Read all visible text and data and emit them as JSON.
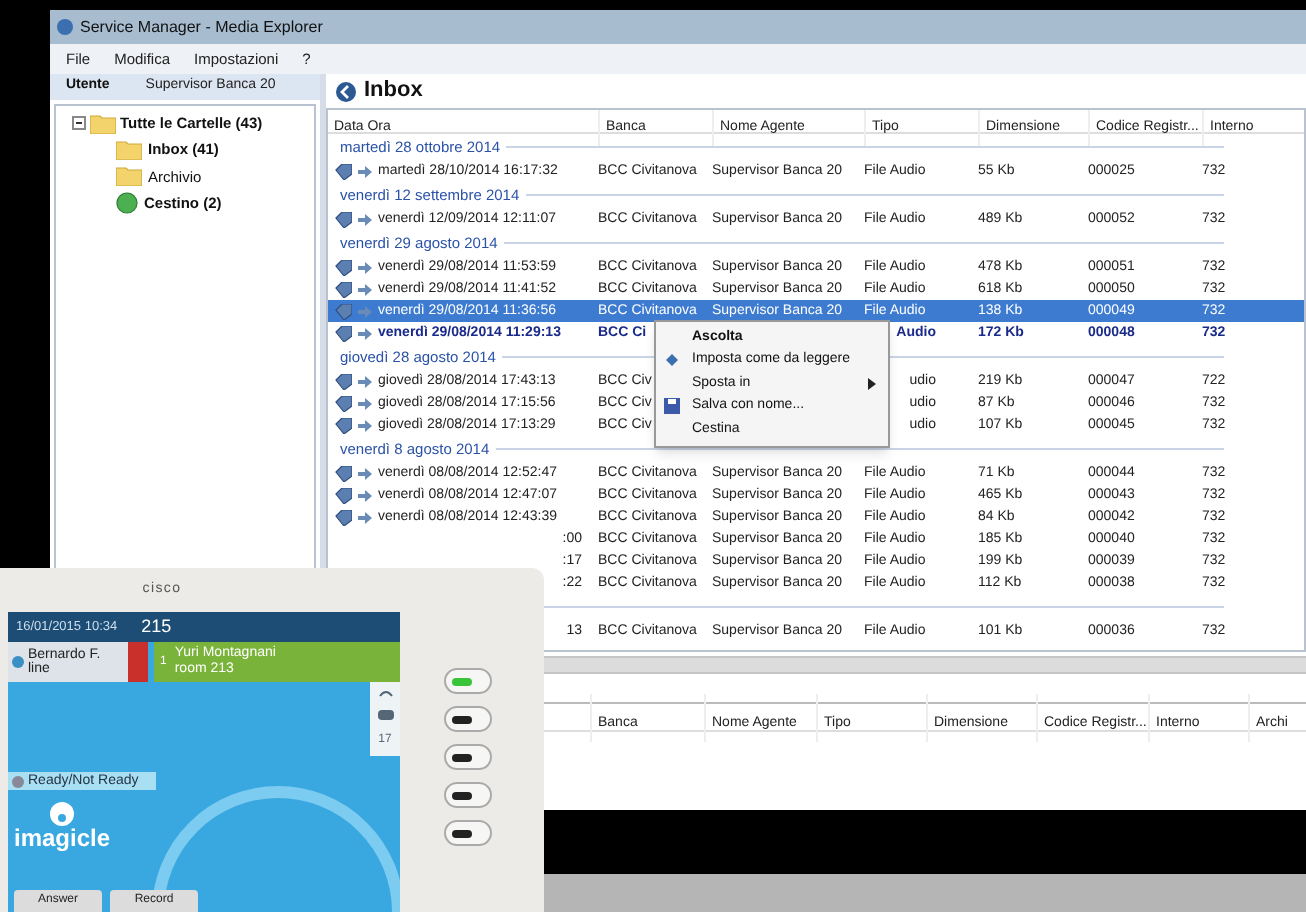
{
  "window": {
    "title": "Service Manager - Media Explorer"
  },
  "menu": [
    "File",
    "Modifica",
    "Impostazioni",
    "?"
  ],
  "user_bar": {
    "label": "Utente",
    "value": "Supervisor Banca 20"
  },
  "folders": {
    "label": "Tutte le Cartelle (43)",
    "expanded": true,
    "unread": true,
    "children": [
      {
        "label": "Inbox (41)",
        "kind": "folder",
        "unread": true
      },
      {
        "label": "Archivio",
        "kind": "folder",
        "unread": false
      },
      {
        "label": "Cestino (2)",
        "kind": "trash",
        "unread": true
      }
    ]
  },
  "pane_title": "Inbox",
  "table": {
    "columns": [
      "Data Ora",
      "Banca",
      "Nome Agente",
      "Tipo",
      "Dimensione",
      "Codice Registr...",
      "Interno"
    ],
    "groups": [
      {
        "label": "martedì 28 ottobre 2014",
        "rows": [
          {
            "cells": [
              "martedì 28/10/2014 16:17:32",
              "BCC Civitanova",
              "Supervisor Banca 20",
              "File Audio",
              "55 Kb",
              "000025",
              "732"
            ],
            "selected": false,
            "unread": false
          }
        ]
      },
      {
        "label": "venerdì 12 settembre 2014",
        "rows": [
          {
            "cells": [
              "venerdì 12/09/2014 12:11:07",
              "BCC Civitanova",
              "Supervisor Banca 20",
              "File Audio",
              "489 Kb",
              "000052",
              "732"
            ],
            "selected": false,
            "unread": false
          }
        ]
      },
      {
        "label": "venerdì 29 agosto 2014",
        "rows": [
          {
            "cells": [
              "venerdì 29/08/2014 11:53:59",
              "BCC Civitanova",
              "Supervisor Banca 20",
              "File Audio",
              "478 Kb",
              "000051",
              "732"
            ],
            "selected": false,
            "unread": false
          },
          {
            "cells": [
              "venerdì 29/08/2014 11:41:52",
              "BCC Civitanova",
              "Supervisor Banca 20",
              "File Audio",
              "618 Kb",
              "000050",
              "732"
            ],
            "selected": false,
            "unread": false
          },
          {
            "cells": [
              "venerdì 29/08/2014 11:36:56",
              "BCC Civitanova",
              "Supervisor Banca 20",
              "File Audio",
              "138 Kb",
              "000049",
              "732"
            ],
            "selected": true,
            "unread": false
          },
          {
            "cells": [
              "venerdì 29/08/2014 11:29:13",
              "BCC Ci",
              "",
              "Audio",
              "172 Kb",
              "000048",
              "732"
            ],
            "selected": false,
            "unread": true,
            "kind": "behind_menu"
          }
        ]
      },
      {
        "label": "giovedì 28 agosto 2014",
        "rows": [
          {
            "cells": [
              "giovedì 28/08/2014 17:43:13",
              "BCC Civ",
              "",
              "udio",
              "219 Kb",
              "000047",
              "722"
            ],
            "selected": false,
            "unread": false,
            "kind": "behind_menu"
          },
          {
            "cells": [
              "giovedì 28/08/2014 17:15:56",
              "BCC Civ",
              "",
              "udio",
              "87 Kb",
              "000046",
              "732"
            ],
            "selected": false,
            "unread": false,
            "kind": "behind_menu"
          },
          {
            "cells": [
              "giovedì 28/08/2014 17:13:29",
              "BCC Civ",
              "",
              "udio",
              "107 Kb",
              "000045",
              "732"
            ],
            "selected": false,
            "unread": false,
            "kind": "behind_menu"
          }
        ]
      },
      {
        "label": "venerdì 8 agosto 2014",
        "rows": [
          {
            "cells": [
              "venerdì 08/08/2014 12:52:47",
              "BCC Civitanova",
              "Supervisor Banca 20",
              "File Audio",
              "71 Kb",
              "000044",
              "732"
            ],
            "selected": false,
            "unread": false
          },
          {
            "cells": [
              "venerdì 08/08/2014 12:47:07",
              "BCC Civitanova",
              "Supervisor Banca 20",
              "File Audio",
              "465 Kb",
              "000043",
              "732"
            ],
            "selected": false,
            "unread": false
          },
          {
            "cells": [
              "venerdì 08/08/2014 12:43:39",
              "BCC Civitanova",
              "Supervisor Banca 20",
              "File Audio",
              "84 Kb",
              "000042",
              "732"
            ],
            "selected": false,
            "unread": false
          },
          {
            "cells": [
              ":00",
              "BCC Civitanova",
              "Supervisor Banca 20",
              "File Audio",
              "185 Kb",
              "000040",
              "732"
            ],
            "selected": false,
            "unread": false,
            "kind": "covered"
          },
          {
            "cells": [
              ":17",
              "BCC Civitanova",
              "Supervisor Banca 20",
              "File Audio",
              "199 Kb",
              "000039",
              "732"
            ],
            "selected": false,
            "unread": false,
            "kind": "covered"
          },
          {
            "cells": [
              ":22",
              "BCC Civitanova",
              "Supervisor Banca 20",
              "File Audio",
              "112 Kb",
              "000038",
              "732"
            ],
            "selected": false,
            "unread": false,
            "kind": "covered"
          }
        ]
      },
      {
        "rows": [
          {
            "cells": [
              "13",
              "BCC Civitanova",
              "Supervisor Banca 20",
              "File Audio",
              "101 Kb",
              "000036",
              "732"
            ],
            "selected": false,
            "unread": false,
            "kind": "covered"
          }
        ]
      }
    ]
  },
  "context_menu": [
    {
      "label": "Ascolta",
      "kind": "default",
      "submenu": false
    },
    {
      "label": "Imposta come da leggere",
      "kind": "mark",
      "submenu": false
    },
    {
      "label": "Sposta in",
      "kind": "plain",
      "submenu": true
    },
    {
      "label": "Salva con nome...",
      "kind": "save",
      "submenu": false
    },
    {
      "label": "Cestina",
      "kind": "plain",
      "submenu": false
    }
  ],
  "bottom_table": {
    "columns": [
      "Banca",
      "Nome Agente",
      "Tipo",
      "Dimensione",
      "Codice Registr...",
      "Interno",
      "Archi"
    ]
  },
  "phone": {
    "brand": "cisco",
    "datetime": "16/01/2015 10:34",
    "extension": "215",
    "line": {
      "name": "Bernardo F.",
      "sub": "line"
    },
    "call": {
      "number": "1",
      "name": "Yuri Montagnani",
      "room": "room 213"
    },
    "side_badge": "17",
    "ready_button": "Ready/Not Ready",
    "logo": "imagicle",
    "softkeys": [
      "Answer",
      "Record"
    ],
    "line_keys": [
      {
        "lit": true
      },
      {
        "lit": false
      },
      {
        "lit": false
      },
      {
        "lit": false
      },
      {
        "lit": false
      }
    ]
  }
}
